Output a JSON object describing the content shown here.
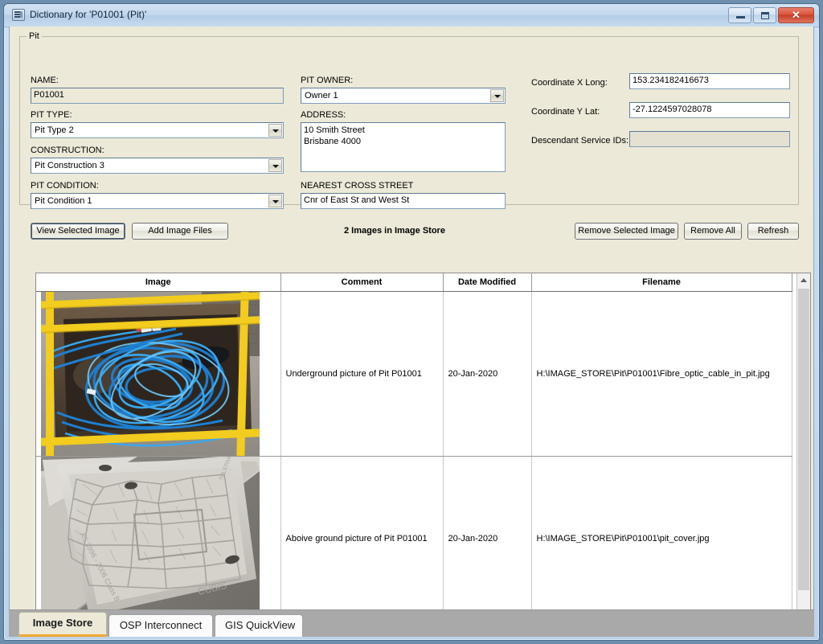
{
  "window": {
    "title": "Dictionary for 'P01001 (Pit)'",
    "icon": "dictionary-icon",
    "minimize_label": "",
    "maximize_label": "",
    "close_label": "✕"
  },
  "group": {
    "legend": "Pit"
  },
  "form": {
    "name": {
      "label": "NAME:",
      "value": "P01001"
    },
    "pit_type": {
      "label": "PIT TYPE:",
      "value": "Pit Type 2"
    },
    "construction": {
      "label": "CONSTRUCTION:",
      "value": "Pit Construction 3"
    },
    "pit_condition": {
      "label": "PIT CONDITION:",
      "value": "Pit Condition 1"
    },
    "pit_owner": {
      "label": "PIT OWNER:",
      "value": "Owner 1"
    },
    "address": {
      "label": "ADDRESS:",
      "value": "10 Smith Street\nBrisbane 4000"
    },
    "nearest_cross_street": {
      "label": "NEAREST CROSS STREET",
      "value": "Cnr of East St and West St"
    },
    "coord_x": {
      "label": "Coordinate X Long:",
      "value": "153.234182416673"
    },
    "coord_y": {
      "label": "Coordinate Y Lat:",
      "value": "-27.1224597028078"
    },
    "descendant_service_ids": {
      "label": "Descendant Service IDs:",
      "value": ""
    }
  },
  "toolbar": {
    "view_selected_image": "View Selected Image",
    "add_image_files": "Add Image Files",
    "status": "2 Images in Image Store",
    "remove_selected_image": "Remove Selected Image",
    "remove_all": "Remove All",
    "refresh": "Refresh"
  },
  "table": {
    "headers": [
      "Image",
      "Comment",
      "Date Modified",
      "Filename"
    ],
    "rows": [
      {
        "image_alt": "underground-fibre-optic-cable-in-pit-photo",
        "comment": "Underground picture of Pit P01001",
        "date_modified": "20-Jan-2020",
        "filename": "H:\\IMAGE_STORE\\Pit\\P01001\\Fibre_optic_cable_in_pit.jpg"
      },
      {
        "image_alt": "above-ground-concrete-pit-cover-photo",
        "comment": "Aboive ground picture of Pit P01001",
        "date_modified": "20-Jan-2020",
        "filename": "H:\\IMAGE_STORE\\Pit\\P01001\\pit_cover.jpg"
      }
    ]
  },
  "tabs": [
    {
      "label": "Image Store",
      "active": true
    },
    {
      "label": "OSP Interconnect",
      "active": false
    },
    {
      "label": "GIS QuickView",
      "active": false
    }
  ],
  "colors": {
    "accent_tab_underline": "#f0a830",
    "window_face": "#ece9d8",
    "title_gradient_top": "#d3e3f4",
    "close_button": "#c63f27"
  }
}
